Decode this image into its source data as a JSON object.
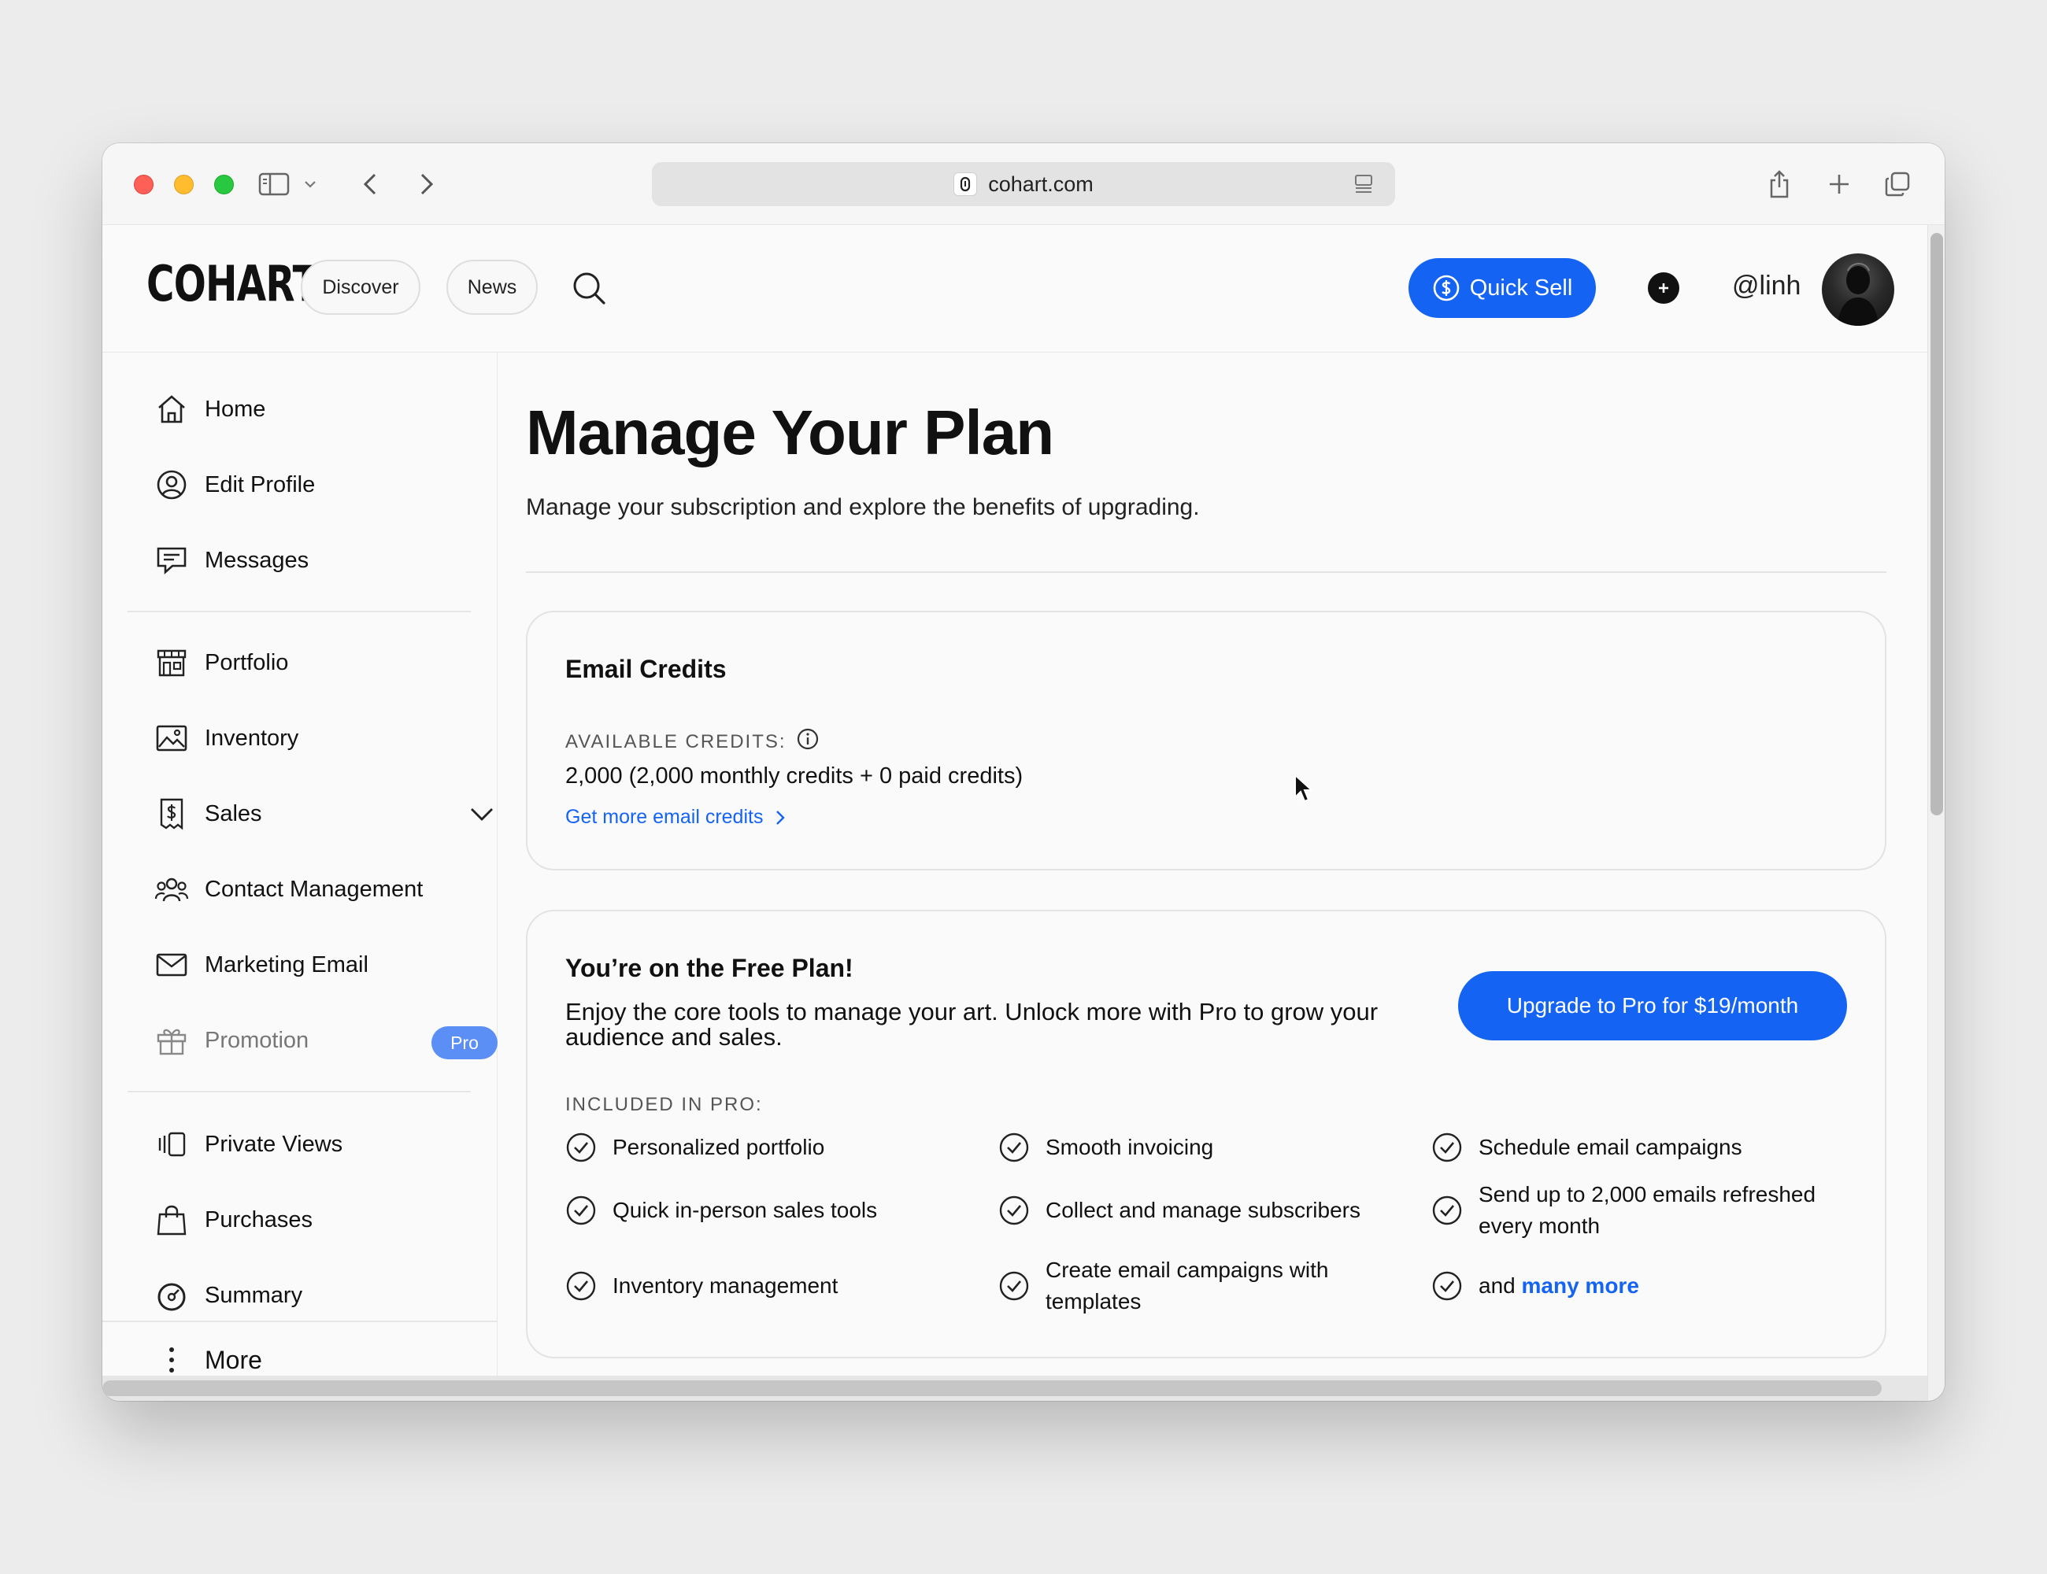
{
  "browser": {
    "url": "cohart.com"
  },
  "header": {
    "logo": "COHART",
    "nav": [
      "Discover",
      "News"
    ],
    "quick_sell": "Quick Sell",
    "handle": "@linh"
  },
  "sidebar": {
    "items": [
      {
        "label": "Home",
        "icon": "home-icon"
      },
      {
        "label": "Edit Profile",
        "icon": "user-circle-icon"
      },
      {
        "label": "Messages",
        "icon": "chat-icon"
      },
      {
        "label": "Portfolio",
        "icon": "storefront-icon"
      },
      {
        "label": "Inventory",
        "icon": "image-icon"
      },
      {
        "label": "Sales",
        "icon": "dollar-receipt-icon"
      },
      {
        "label": "Contact Management",
        "icon": "users-icon"
      },
      {
        "label": "Marketing Email",
        "icon": "mail-icon"
      },
      {
        "label": "Promotion",
        "icon": "gift-icon",
        "badge": "Pro"
      },
      {
        "label": "Private Views",
        "icon": "private-views-icon"
      },
      {
        "label": "Purchases",
        "icon": "shopping-bag-icon"
      },
      {
        "label": "Summary",
        "icon": "chart-circle-icon"
      }
    ],
    "more": "More"
  },
  "main": {
    "title": "Manage Your Plan",
    "subtitle": "Manage your subscription and explore the benefits of upgrading.",
    "credits": {
      "heading": "Email Credits",
      "label": "AVAILABLE CREDITS:",
      "value": "2,000 (2,000 monthly credits + 0 paid credits)",
      "link": "Get more email credits"
    },
    "plan": {
      "heading": "You’re on the Free Plan!",
      "description": "Enjoy the core tools to manage your art. Unlock more with Pro to grow your audience and sales.",
      "upgrade": "Upgrade to Pro for $19/month",
      "included_label": "INCLUDED IN PRO:",
      "features": [
        "Personalized portfolio",
        "Smooth invoicing",
        "Schedule email campaigns",
        "Quick in-person sales tools",
        "Collect and manage subscribers",
        "Send up to 2,000 emails refreshed every month",
        "Inventory management",
        "Create email campaigns with templates",
        "and"
      ],
      "many_more": "many more"
    }
  },
  "colors": {
    "accent": "#1463f3",
    "badge": "#5b8ff6"
  }
}
